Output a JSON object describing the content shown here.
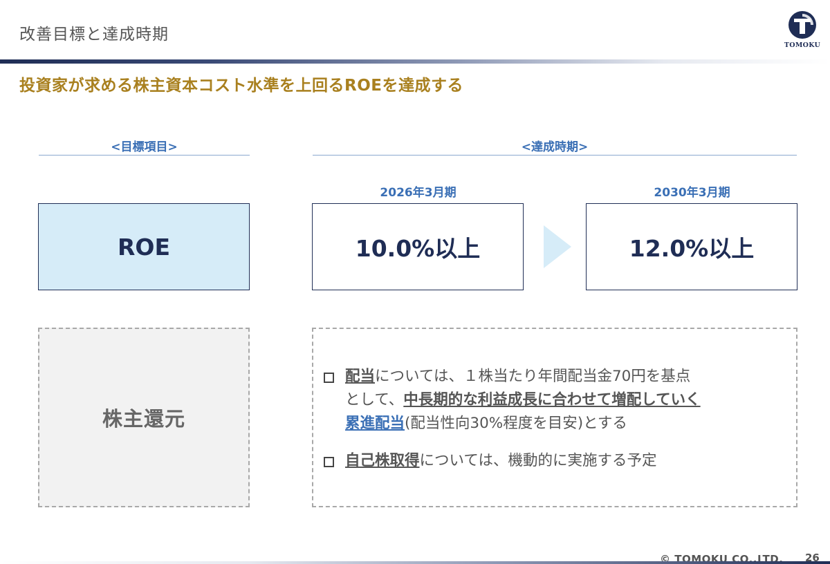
{
  "header": {
    "title": "改善目標と達成時期",
    "logo_text": "TOMOKU"
  },
  "subtitle": "投資家が求める株主資本コスト水準を上回るROEを達成する",
  "sections": {
    "target_label": "<目標項目>",
    "period_label": "<達成時期>"
  },
  "periods": [
    {
      "label": "2026年3月期",
      "value": "10.0%以上"
    },
    {
      "label": "2030年3月期",
      "value": "12.0%以上"
    }
  ],
  "target_item": "ROE",
  "shareholder_return": {
    "label": "株主還元",
    "bullet1": {
      "kw": "配当",
      "text1": "については、１株当たり年間配当金70円を基点",
      "text2": "として、",
      "emph": "中長期的な利益成長に合わせて増配していく",
      "kw2": "累進配当",
      "text3": "(配当性向30%程度を目安)とする"
    },
    "bullet2": {
      "kw": "自己株取得",
      "text": "については、機動的に実施する予定"
    }
  },
  "footer": {
    "copyright": "© TOMOKU CO.,LTD.",
    "page_number": "26"
  },
  "colors": {
    "navy": "#1f2d55",
    "gold": "#a9801f",
    "accent_blue": "#3a6fb5",
    "light_blue": "#d6ecf8"
  }
}
